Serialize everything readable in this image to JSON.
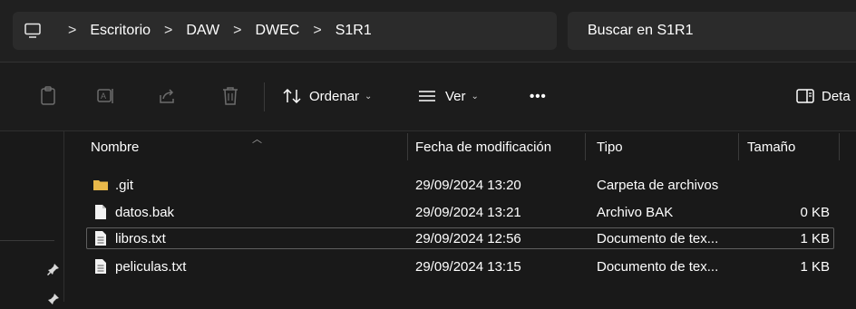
{
  "address": {
    "segments": [
      "Escritorio",
      "DAW",
      "DWEC",
      "S1R1"
    ],
    "separator": ">",
    "icon": "computer-icon"
  },
  "search": {
    "placeholder": "Buscar en S1R1"
  },
  "toolbar": {
    "icons": [
      "paste-icon",
      "rename-icon",
      "share-icon",
      "delete-icon"
    ],
    "sort_label": "Ordenar",
    "view_label": "Ver",
    "more_label": "•••",
    "details_label": "Deta"
  },
  "columns": {
    "name": "Nombre",
    "date": "Fecha de modificación",
    "type": "Tipo",
    "size": "Tamaño"
  },
  "files": [
    {
      "name": ".git",
      "date": "29/09/2024 13:20",
      "type": "Carpeta de archivos",
      "size": "",
      "icon": "folder-icon",
      "selected": false
    },
    {
      "name": "datos.bak",
      "date": "29/09/2024 13:21",
      "type": "Archivo BAK",
      "size": "0 KB",
      "icon": "file-icon",
      "selected": false
    },
    {
      "name": "libros.txt",
      "date": "29/09/2024 12:56",
      "type": "Documento de tex...",
      "size": "1 KB",
      "icon": "text-file-icon",
      "selected": true
    },
    {
      "name": "peliculas.txt",
      "date": "29/09/2024 13:15",
      "type": "Documento de tex...",
      "size": "1 KB",
      "icon": "text-file-icon",
      "selected": false
    }
  ],
  "colors": {
    "background": "#191919",
    "folder": "#e8b84a",
    "text": "#ffffff"
  }
}
